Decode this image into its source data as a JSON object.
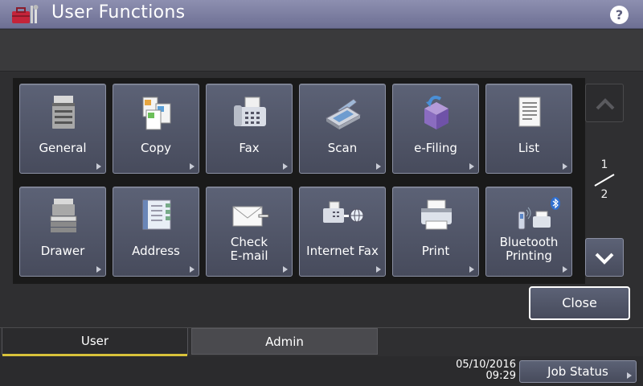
{
  "header": {
    "title": "User Functions",
    "help_label": "?",
    "app_icon": "toolbox-icon"
  },
  "grid": {
    "buttons": [
      {
        "label": "General",
        "icon": "multifunction-printer-icon"
      },
      {
        "label": "Copy",
        "icon": "copy-documents-icon"
      },
      {
        "label": "Fax",
        "icon": "fax-machine-icon"
      },
      {
        "label": "Scan",
        "icon": "scanner-icon"
      },
      {
        "label": "e-Filing",
        "icon": "filing-box-icon"
      },
      {
        "label": "List",
        "icon": "list-document-icon"
      },
      {
        "label": "Drawer",
        "icon": "drawer-printer-icon"
      },
      {
        "label": "Address",
        "icon": "address-book-icon"
      },
      {
        "label": "Check\nE-mail",
        "icon": "email-envelope-icon"
      },
      {
        "label": "Internet Fax",
        "icon": "internet-fax-icon"
      },
      {
        "label": "Print",
        "icon": "printer-icon"
      },
      {
        "label": "Bluetooth\nPrinting",
        "icon": "bluetooth-printing-icon"
      }
    ]
  },
  "pager": {
    "current": "1",
    "total": "2"
  },
  "actions": {
    "close_label": "Close"
  },
  "tabs": [
    {
      "label": "User",
      "active": true
    },
    {
      "label": "Admin",
      "active": false
    }
  ],
  "status": {
    "date": "05/10/2016",
    "time": "09:29",
    "job_status_label": "Job Status"
  },
  "colors": {
    "title_bar": "#7d7fa3",
    "active_tab_indicator": "#d8c23a",
    "button_face": "#525769"
  }
}
